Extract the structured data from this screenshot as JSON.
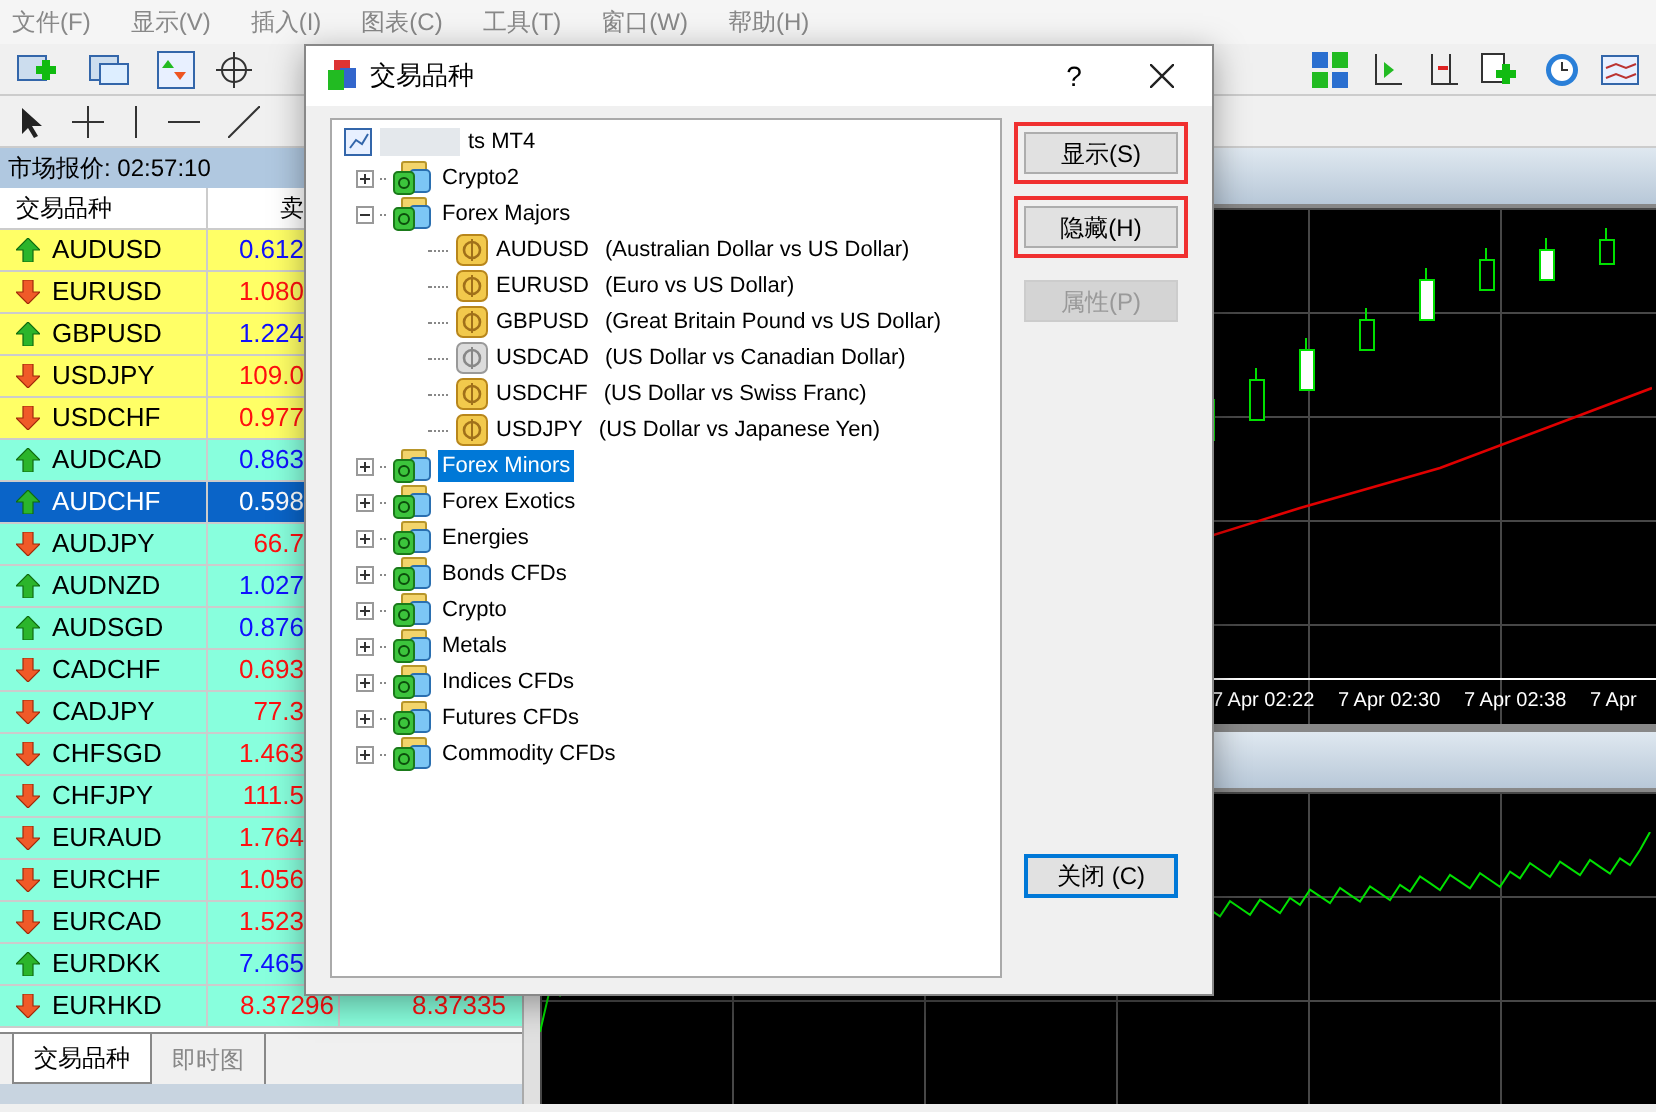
{
  "menu": [
    "文件(F)",
    "显示(V)",
    "插入(I)",
    "图表(C)",
    "工具(T)",
    "窗口(W)",
    "帮助(H)"
  ],
  "market_watch": {
    "title": "市场报价: 02:57:10",
    "columns": [
      "交易品种",
      "卖"
    ],
    "rows": [
      {
        "symbol": "AUDUSD",
        "bid": "0.612",
        "rising": true,
        "color": "#ffff66",
        "selected": false
      },
      {
        "symbol": "EURUSD",
        "bid": "1.080",
        "rising": false,
        "color": "#ffff66",
        "selected": false
      },
      {
        "symbol": "GBPUSD",
        "bid": "1.224",
        "rising": true,
        "color": "#ffff66",
        "selected": false
      },
      {
        "symbol": "USDJPY",
        "bid": "109.0",
        "rising": false,
        "color": "#ffff66",
        "selected": false
      },
      {
        "symbol": "USDCHF",
        "bid": "0.977",
        "rising": false,
        "color": "#ffff66",
        "selected": false
      },
      {
        "symbol": "AUDCAD",
        "bid": "0.863",
        "rising": true,
        "color": "#88ffdd",
        "selected": false
      },
      {
        "symbol": "AUDCHF",
        "bid": "0.598",
        "rising": true,
        "selected": true
      },
      {
        "symbol": "AUDJPY",
        "bid": "66.7",
        "rising": false,
        "color": "#88ffdd",
        "selected": false
      },
      {
        "symbol": "AUDNZD",
        "bid": "1.027",
        "rising": true,
        "color": "#88ffdd",
        "selected": false
      },
      {
        "symbol": "AUDSGD",
        "bid": "0.876",
        "rising": true,
        "color": "#88ffdd",
        "selected": false
      },
      {
        "symbol": "CADCHF",
        "bid": "0.693",
        "rising": false,
        "color": "#88ffdd",
        "selected": false
      },
      {
        "symbol": "CADJPY",
        "bid": "77.3",
        "rising": false,
        "color": "#88ffdd",
        "selected": false
      },
      {
        "symbol": "CHFSGD",
        "bid": "1.463",
        "rising": false,
        "color": "#88ffdd",
        "selected": false
      },
      {
        "symbol": "CHFJPY",
        "bid": "111.5",
        "rising": false,
        "color": "#88ffdd",
        "selected": false
      },
      {
        "symbol": "EURAUD",
        "bid": "1.764",
        "rising": false,
        "color": "#88ffdd",
        "selected": false
      },
      {
        "symbol": "EURCHF",
        "bid": "1.056",
        "rising": false,
        "color": "#88ffdd",
        "selected": false
      },
      {
        "symbol": "EURCAD",
        "bid": "1.523",
        "rising": false,
        "color": "#88ffdd",
        "selected": false
      },
      {
        "symbol": "EURDKK",
        "bid": "7.465",
        "rising": true,
        "color": "#88ffdd",
        "selected": false
      },
      {
        "symbol": "EURHKD",
        "bid": "8.37296",
        "ask": "8.37335",
        "rising": false,
        "color": "#88ffdd",
        "selected": false
      }
    ],
    "tabs": [
      {
        "label": "交易品种",
        "selected": true
      },
      {
        "label": "即时图",
        "selected": false
      }
    ]
  },
  "chart": {
    "time_labels": [
      "7 Apr 02:22",
      "7 Apr 02:30",
      "7 Apr 02:38",
      "7 Apr"
    ]
  },
  "dialog": {
    "title": "交易品种",
    "help": "?",
    "tree": {
      "label": "ts MT4",
      "children": [
        {
          "label": "Crypto2",
          "expanded": false,
          "selected": false
        },
        {
          "label": "Forex Majors",
          "expanded": true,
          "selected": false,
          "children": [
            {
              "symbol": "AUDUSD",
              "description": "(Australian Dollar vs US Dollar)",
              "shown": true
            },
            {
              "symbol": "EURUSD",
              "description": "(Euro vs US Dollar)",
              "shown": true
            },
            {
              "symbol": "GBPUSD",
              "description": "(Great Britain Pound vs US Dollar)",
              "shown": true
            },
            {
              "symbol": "USDCAD",
              "description": "(US Dollar vs Canadian Dollar)",
              "shown": false
            },
            {
              "symbol": "USDCHF",
              "description": "(US Dollar vs Swiss Franc)",
              "shown": true
            },
            {
              "symbol": "USDJPY",
              "description": "(US Dollar vs Japanese Yen)",
              "shown": true
            }
          ]
        },
        {
          "label": "Forex Minors",
          "expanded": false,
          "selected": true
        },
        {
          "label": "Forex Exotics",
          "expanded": false,
          "selected": false
        },
        {
          "label": "Energies",
          "expanded": false,
          "selected": false
        },
        {
          "label": "Bonds CFDs",
          "expanded": false,
          "selected": false
        },
        {
          "label": "Crypto",
          "expanded": false,
          "selected": false
        },
        {
          "label": "Metals",
          "expanded": false,
          "selected": false
        },
        {
          "label": "Indices CFDs",
          "expanded": false,
          "selected": false
        },
        {
          "label": "Futures CFDs",
          "expanded": false,
          "selected": false
        },
        {
          "label": "Commodity CFDs",
          "expanded": false,
          "selected": false
        }
      ]
    },
    "buttons": [
      {
        "label": "显示(S)",
        "disabled": false,
        "highlighted": true
      },
      {
        "label": "隐藏(H)",
        "disabled": false,
        "highlighted": true
      },
      {
        "label": "属性(P)",
        "disabled": true,
        "highlighted": false
      }
    ],
    "close_button": {
      "label": "关闭 (C)",
      "focused": true
    }
  }
}
